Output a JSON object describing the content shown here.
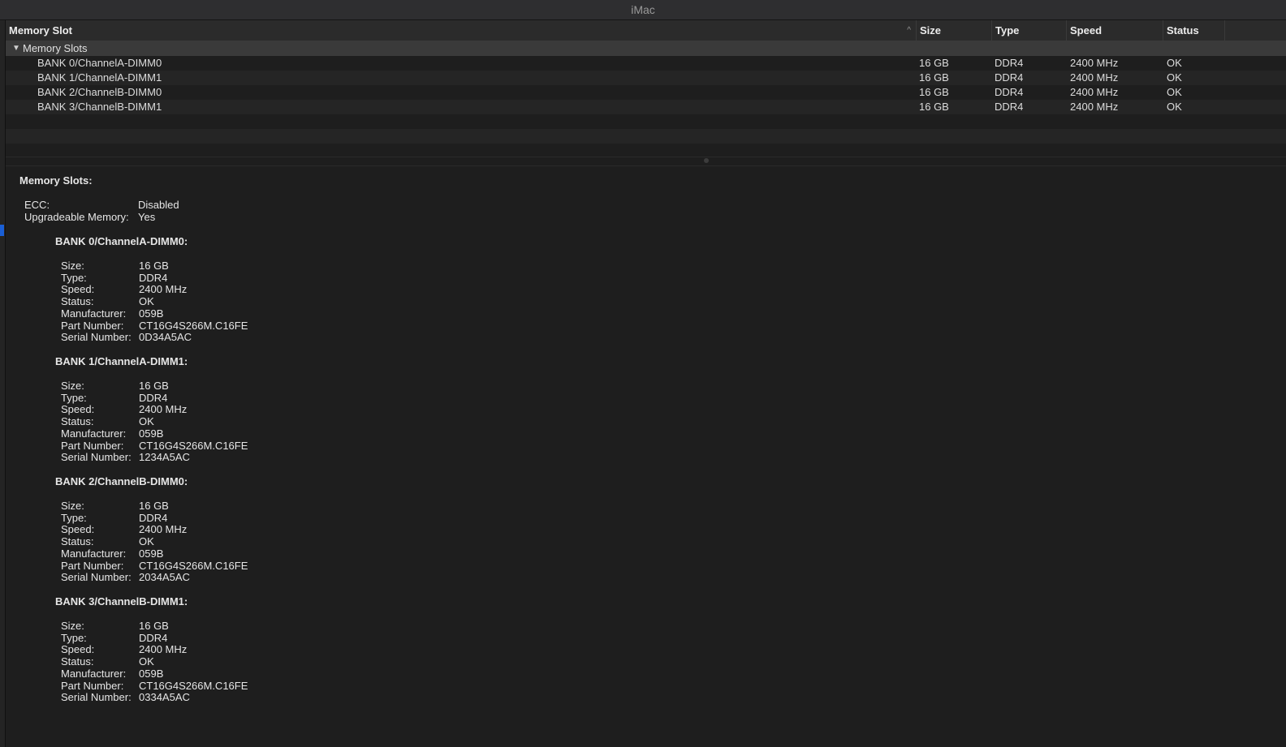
{
  "window": {
    "title": "iMac"
  },
  "table": {
    "columns": [
      "Memory Slot",
      "Size",
      "Type",
      "Speed",
      "Status"
    ],
    "group": {
      "label": "Memory Slots"
    },
    "rows": [
      [
        "BANK 0/ChannelA-DIMM0",
        "16 GB",
        "DDR4",
        "2400 MHz",
        "OK"
      ],
      [
        "BANK 1/ChannelA-DIMM1",
        "16 GB",
        "DDR4",
        "2400 MHz",
        "OK"
      ],
      [
        "BANK 2/ChannelB-DIMM0",
        "16 GB",
        "DDR4",
        "2400 MHz",
        "OK"
      ],
      [
        "BANK 3/ChannelB-DIMM1",
        "16 GB",
        "DDR4",
        "2400 MHz",
        "OK"
      ]
    ]
  },
  "details": {
    "heading": "Memory Slots:",
    "summary": [
      {
        "label": "ECC:",
        "value": "Disabled"
      },
      {
        "label": "Upgradeable Memory:",
        "value": "Yes"
      }
    ],
    "banks": [
      {
        "title": "BANK 0/ChannelA-DIMM0:",
        "fields": [
          {
            "label": "Size:",
            "value": "16 GB"
          },
          {
            "label": "Type:",
            "value": "DDR4"
          },
          {
            "label": "Speed:",
            "value": "2400 MHz"
          },
          {
            "label": "Status:",
            "value": "OK"
          },
          {
            "label": "Manufacturer:",
            "value": "059B"
          },
          {
            "label": "Part Number:",
            "value": "CT16G4S266M.C16FE"
          },
          {
            "label": "Serial Number:",
            "value": "0D34A5AC"
          }
        ]
      },
      {
        "title": "BANK 1/ChannelA-DIMM1:",
        "fields": [
          {
            "label": "Size:",
            "value": "16 GB"
          },
          {
            "label": "Type:",
            "value": "DDR4"
          },
          {
            "label": "Speed:",
            "value": "2400 MHz"
          },
          {
            "label": "Status:",
            "value": "OK"
          },
          {
            "label": "Manufacturer:",
            "value": "059B"
          },
          {
            "label": "Part Number:",
            "value": "CT16G4S266M.C16FE"
          },
          {
            "label": "Serial Number:",
            "value": "1234A5AC"
          }
        ]
      },
      {
        "title": "BANK 2/ChannelB-DIMM0:",
        "fields": [
          {
            "label": "Size:",
            "value": "16 GB"
          },
          {
            "label": "Type:",
            "value": "DDR4"
          },
          {
            "label": "Speed:",
            "value": "2400 MHz"
          },
          {
            "label": "Status:",
            "value": "OK"
          },
          {
            "label": "Manufacturer:",
            "value": "059B"
          },
          {
            "label": "Part Number:",
            "value": "CT16G4S266M.C16FE"
          },
          {
            "label": "Serial Number:",
            "value": "2034A5AC"
          }
        ]
      },
      {
        "title": "BANK 3/ChannelB-DIMM1:",
        "fields": [
          {
            "label": "Size:",
            "value": "16 GB"
          },
          {
            "label": "Type:",
            "value": "DDR4"
          },
          {
            "label": "Speed:",
            "value": "2400 MHz"
          },
          {
            "label": "Status:",
            "value": "OK"
          },
          {
            "label": "Manufacturer:",
            "value": "059B"
          },
          {
            "label": "Part Number:",
            "value": "CT16G4S266M.C16FE"
          },
          {
            "label": "Serial Number:",
            "value": "0334A5AC"
          }
        ]
      }
    ]
  },
  "icons": {
    "sort": "chevron-up-icon",
    "disclosure": "disclosure-triangle-down-icon"
  },
  "colors": {
    "background": "#1e1e1e",
    "header": "#2b2b2b",
    "group_row": "#3a3a3a",
    "selection_accent": "#1a5fd6"
  }
}
